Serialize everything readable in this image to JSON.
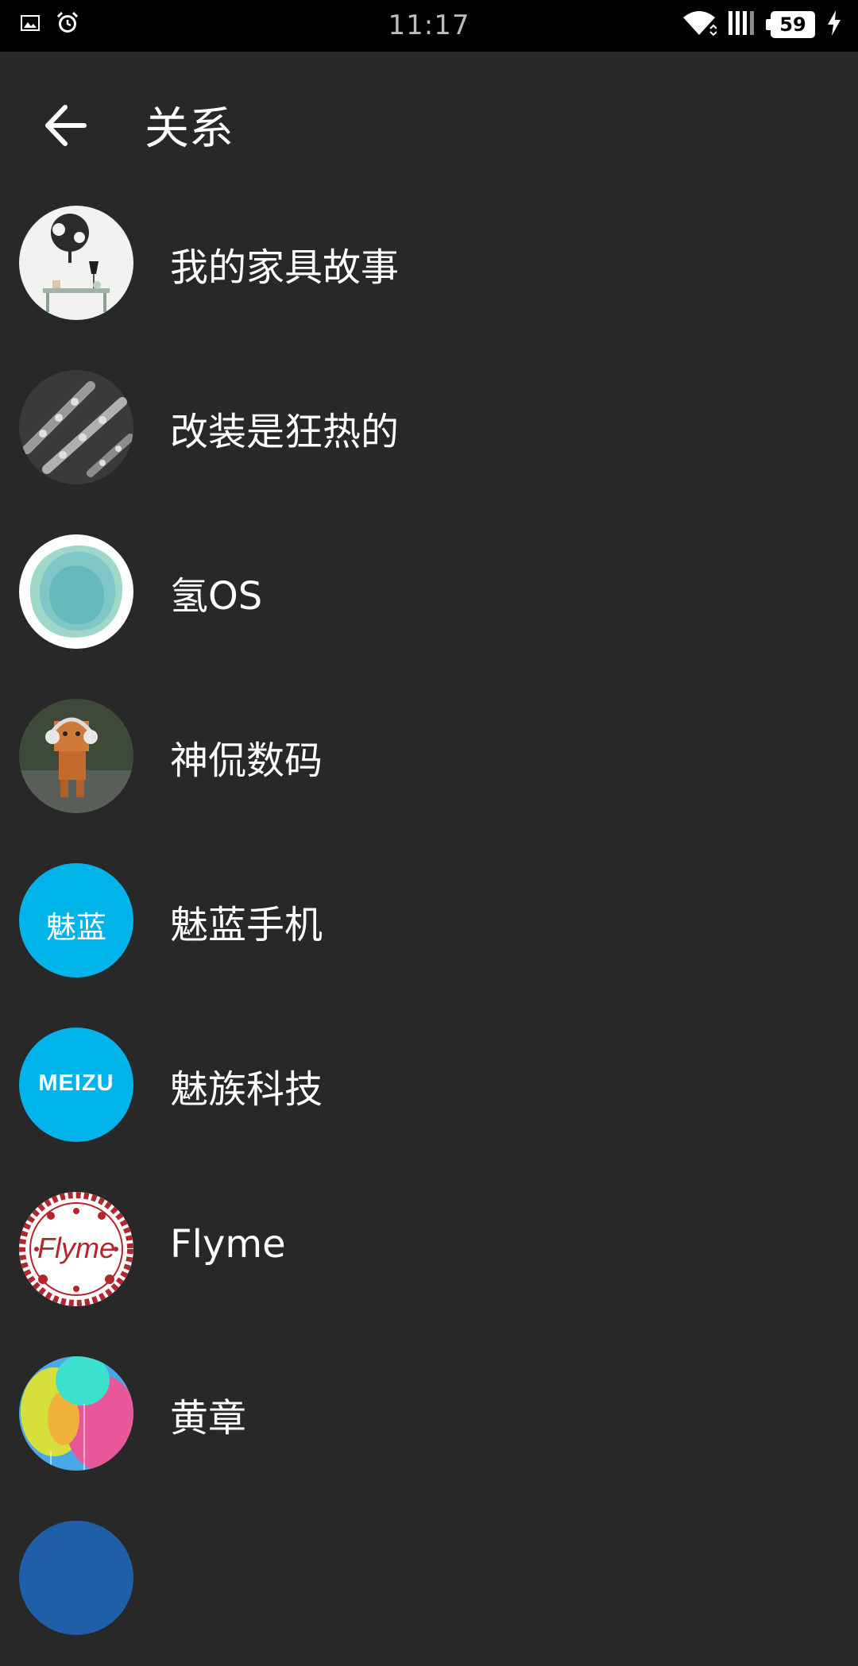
{
  "status_bar": {
    "time": "11:17",
    "battery": "59",
    "icons": [
      "image-icon",
      "alarm-icon",
      "wifi-icon",
      "signal-icon",
      "battery-icon",
      "charging-icon"
    ]
  },
  "header": {
    "title": "关系",
    "back_icon": "arrow-left-icon"
  },
  "items": [
    {
      "label": "我的家具故事",
      "avatar": "furniture-photo"
    },
    {
      "label": "改装是狂热的",
      "avatar": "camshaft-photo"
    },
    {
      "label": "氢OS",
      "avatar": "hydrogen-os-logo"
    },
    {
      "label": "神侃数码",
      "avatar": "danbo-robot-photo"
    },
    {
      "label": "魅蓝手机",
      "avatar": "meilan-logo",
      "avatar_text": "魅蓝"
    },
    {
      "label": "魅族科技",
      "avatar": "meizu-logo",
      "avatar_text": "MEIZU"
    },
    {
      "label": "Flyme",
      "avatar": "flyme-logo",
      "avatar_text": "Flyme"
    },
    {
      "label": "黄章",
      "avatar": "balloon-photo"
    }
  ],
  "colors": {
    "background": "#282828",
    "status_bar": "#000000",
    "meizu_blue": "#00b4ea",
    "flyme_red": "#b3262b"
  }
}
